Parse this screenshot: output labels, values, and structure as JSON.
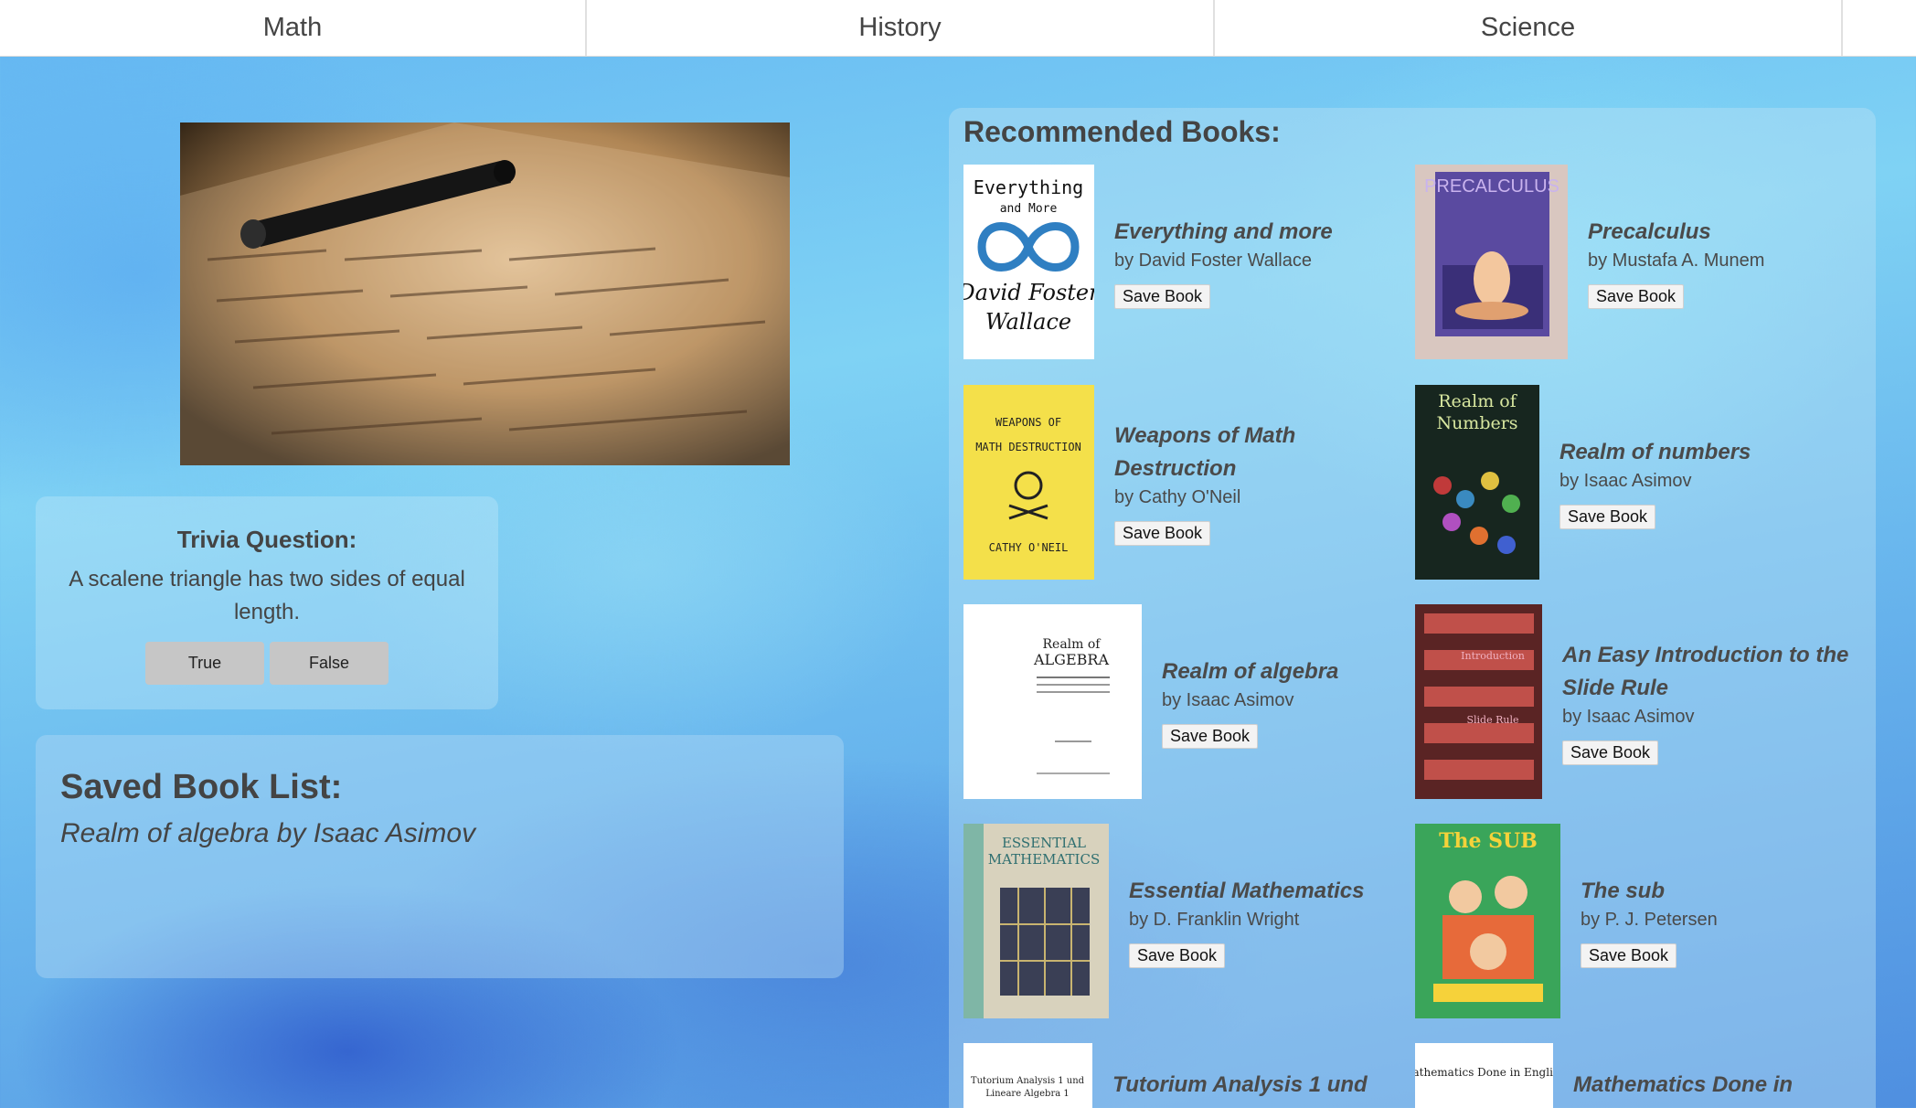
{
  "nav": {
    "tabs": [
      {
        "label": "Math"
      },
      {
        "label": "History"
      },
      {
        "label": "Science"
      },
      {
        "label": ""
      }
    ]
  },
  "trivia": {
    "title": "Trivia Question:",
    "question": "A scalene triangle has two sides of equal length.",
    "true_label": "True",
    "false_label": "False"
  },
  "saved": {
    "title": "Saved Book List:",
    "items": [
      "Realm of algebra by Isaac Asimov"
    ]
  },
  "recs": {
    "title": "Recommended Books:",
    "save_label": "Save Book",
    "books": [
      {
        "title": "Everything and more",
        "author": "by David Foster Wallace",
        "cover_text": "Everything and More · David Foster Wallace",
        "cover_bg": "#ffffff",
        "cover_fg": "#111111"
      },
      {
        "title": "Precalculus",
        "author": "by Mustafa A. Munem",
        "cover_text": "PRECALCULUS",
        "cover_bg": "#d9c7c0",
        "cover_fg": "#5b3b8a"
      },
      {
        "title": "Weapons of Math Destruction",
        "author": "by Cathy O'Neil",
        "cover_text": "WEAPONS OF MATH DESTRUCTION · CATHY O'NEIL",
        "cover_bg": "#f4e04a",
        "cover_fg": "#222222"
      },
      {
        "title": "Realm of numbers",
        "author": "by Isaac Asimov",
        "cover_text": "Realm of Numbers",
        "cover_bg": "#17261f",
        "cover_fg": "#d9e8a0"
      },
      {
        "title": "Realm of algebra",
        "author": "by Isaac Asimov",
        "cover_text": "Realm of ALGEBRA",
        "cover_bg": "#ffffff",
        "cover_fg": "#222222"
      },
      {
        "title": "An Easy Introduction to the Slide Rule",
        "author": "by Isaac Asimov",
        "cover_text": "An Easy Introduction to the Slide Rule",
        "cover_bg": "#6a2a2a",
        "cover_fg": "#f0b0c0"
      },
      {
        "title": "Essential Mathematics",
        "author": "by D. Franklin Wright",
        "cover_text": "ESSENTIAL MATHEMATICS",
        "cover_bg": "#d8d2bd",
        "cover_fg": "#2f6f70"
      },
      {
        "title": "The sub",
        "author": "by P. J. Petersen",
        "cover_text": "The SUB",
        "cover_bg": "#3aa55a",
        "cover_fg": "#f6d23a"
      },
      {
        "title": "Tutorium Analysis 1 und",
        "author": "",
        "cover_text": "Tutorium Analysis 1 und Lineare Algebra 1",
        "cover_bg": "#ffffff",
        "cover_fg": "#222222"
      },
      {
        "title": "Mathematics Done in",
        "author": "",
        "cover_text": "Mathematics Done in English",
        "cover_bg": "#ffffff",
        "cover_fg": "#222222"
      }
    ]
  },
  "colors": {
    "nav_bg": "#ffffff",
    "button_gray": "#c6c6c6",
    "text": "#444444"
  }
}
